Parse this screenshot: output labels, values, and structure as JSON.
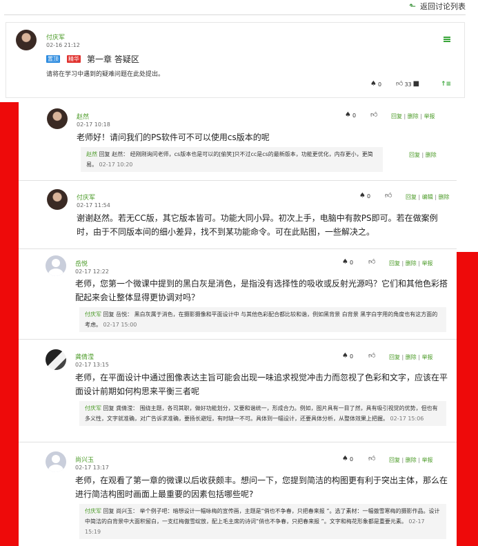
{
  "topbar": {
    "back_label": "返回讨论列表"
  },
  "main_post": {
    "author": "付庆军",
    "time": "02-16 21:12",
    "badge_top": "置顶",
    "badge_best": "精华",
    "title": "第一章 答疑区",
    "description": "请将在学习中遇到的疑难问题在此处提出。",
    "stats": {
      "award": "0",
      "likes": "33"
    }
  },
  "replies": [
    {
      "author": "赵然",
      "time": "02-17 10:18",
      "award": "0",
      "actions": [
        "回复",
        "删除",
        "举报"
      ],
      "text": "老师好！请问我们的PS软件可不可以使用cs版本的呢",
      "sub": {
        "who": "赵然",
        "verb": "回复",
        "target": "赵然：",
        "text": "经刚刚询问老师，cs版本也是可以的[偷笑]只不过cc是cs的最新版本，功能更优化，内存更小，更简易。",
        "time": "02-17 10:20",
        "actions": [
          "回复",
          "删除"
        ]
      }
    },
    {
      "author": "付庆军",
      "time": "02-17 11:54",
      "award": "0",
      "actions": [
        "回复",
        "编辑",
        "删除"
      ],
      "text": "谢谢赵然。若无CC版，其它版本皆可。功能大同小异。初次上手，电脑中有款PS即可。若在做案例时，由于不同版本间的细小差异，找不到某功能命令。可在此贴图，一些解决之。"
    },
    {
      "author": "岳悦",
      "time": "02-17 12:22",
      "award": "0",
      "actions": [
        "回复",
        "删除",
        "举报"
      ],
      "text": "老师，您第一个微课中提到的黑白灰是消色，是指没有选择性的吸收或反射光源吗？它们和其他色彩搭配起来会让整体显得更协调对吗？",
      "sub": {
        "who": "付庆军",
        "verb": "回复",
        "target": "岳悦：",
        "text": "黑白灰属于消色，在摄影摄像和平面设计中 与其他色彩配合都比较和谐，例如黑背景 白背景 黑字白字用的角度也有这方面的考虑。",
        "time": "02-17 15:00"
      }
    },
    {
      "author": "龚倩滢",
      "time": "02-17 13:15",
      "award": "0",
      "actions": [
        "回复",
        "删除",
        "举报"
      ],
      "text": "老师，在平面设计中通过图像表达主旨可能会出现一味追求视觉冲击力而忽视了色彩和文字，应该在平面设计前期如何构思来平衡三者呢",
      "sub": {
        "who": "付庆军",
        "verb": "回复",
        "target": "龚倩滢：",
        "text": "围绕主题，各司其职，做好功能划分，又要和谐统一，形成合力。例如，图片具有一目了然，具有吸引视觉的优势，但也有多义性，文字就准确，对广告诉求准确，要扬长避短，有时缺一不可。具体到一幅设计，还要具体分析，从整体效果上把握。",
        "time": "02-17 15:06"
      }
    },
    {
      "author": "尚兴玉",
      "time": "02-17 13:17",
      "award": "0",
      "actions": [
        "回复",
        "删除",
        "举报"
      ],
      "text": "老师，在观看了第一章的微课以后收获颇丰。想问一下，您提到简洁的构图更有利于突出主体，那么在进行简洁构图时画面上最重要的因素包括哪些呢?",
      "sub": {
        "who": "付庆军",
        "verb": "回复",
        "target": "尚兴玉：",
        "text": "举个例子吧：暗想设计一幅咏梅的宣传画，主题是“俏也不争春，只把春来报 ”。选了素材：一幅傲雪寒梅的摄影作品。设计中简洁的白背景中大面积留白，一支红梅傲雪绽放，配上毛主席的诗词”俏也不争春，只把春来报 ”。文字和梅花形象都是重要元素。",
        "time": "02-17 15:19"
      }
    }
  ]
}
